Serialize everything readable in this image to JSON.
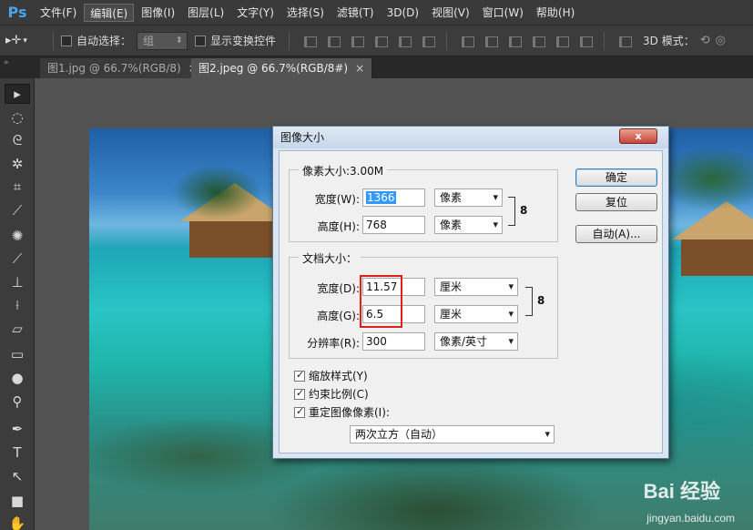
{
  "app": {
    "logo": "Ps"
  },
  "menu": [
    "文件(F)",
    "编辑(E)",
    "图像(I)",
    "图层(L)",
    "文字(Y)",
    "选择(S)",
    "滤镜(T)",
    "3D(D)",
    "视图(V)",
    "窗口(W)",
    "帮助(H)"
  ],
  "options": {
    "auto_select_label": "自动选择：",
    "auto_select_value": "组",
    "show_transform_label": "显示变换控件",
    "mode_3d_label": "3D 模式："
  },
  "tabs": [
    {
      "label": "图1.jpg @ 66.7%(RGB/8)",
      "close": "×"
    },
    {
      "label": "图2.jpeg @ 66.7%(RGB/8#)",
      "close": "×"
    }
  ],
  "dialog": {
    "title": "图像大小",
    "close": "x",
    "pixel_group_title": "像素大小:3.00M",
    "pixel_width_label": "宽度(W):",
    "pixel_width_value": "1366",
    "pixel_width_unit": "像素",
    "pixel_height_label": "高度(H):",
    "pixel_height_value": "768",
    "pixel_height_unit": "像素",
    "doc_group_title": "文档大小：",
    "doc_width_label": "宽度(D):",
    "doc_width_value": "11.57",
    "doc_width_unit": "厘米",
    "doc_height_label": "高度(G):",
    "doc_height_value": "6.5",
    "doc_height_unit": "厘米",
    "resolution_label": "分辨率(R):",
    "resolution_value": "300",
    "resolution_unit": "像素/英寸",
    "scale_styles": "缩放样式(Y)",
    "constrain": "约束比例(C)",
    "resample": "重定图像像素(I):",
    "resample_method": "两次立方（自动）",
    "ok": "确定",
    "reset": "复位",
    "auto": "自动(A)..."
  },
  "watermark": {
    "brand": "Bai 经验",
    "url": "jingyan.baidu.com"
  }
}
